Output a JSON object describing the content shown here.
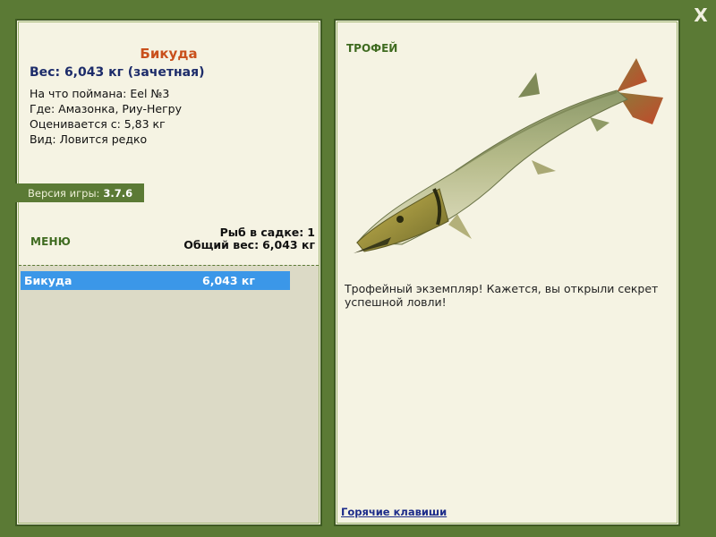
{
  "window": {
    "close_label": "X"
  },
  "fish": {
    "name": "Бикуда",
    "weight_line": "Вес: 6,043 кг (зачетная)",
    "caught_on": "На что поймана: Eel №3",
    "location": "Где: Амазонка, Риу-Негру",
    "valued_from": "Оценивается с: 5,83 кг",
    "species": "Вид: Ловится редко"
  },
  "version": {
    "label": "Версия игры:",
    "value": "3.7.6"
  },
  "menu": {
    "label": "МЕНЮ"
  },
  "keepnet": {
    "count_label": "Рыб в садке:",
    "count_value": "1",
    "total_label": "Общий вес:",
    "total_value": "6,043 кг"
  },
  "catch_list": [
    {
      "name": "Бикуда",
      "weight": "6,043 кг",
      "selected": true
    }
  ],
  "trophy": {
    "label": "ТРОФЕЙ",
    "text": "Трофейный экземпляр! Кажется, вы открыли секрет успешной ловли!",
    "hotkeys_label": "Горячие клавиши"
  },
  "colors": {
    "frame": "#5b7a35",
    "panel": "#f5f3e3",
    "fish_name": "#c9501c",
    "weight": "#1d2c6a",
    "selected_row": "#3b97e8",
    "accent_label": "#3f6b20"
  },
  "icons": {
    "close": "close-icon",
    "fish": "fish-image"
  }
}
